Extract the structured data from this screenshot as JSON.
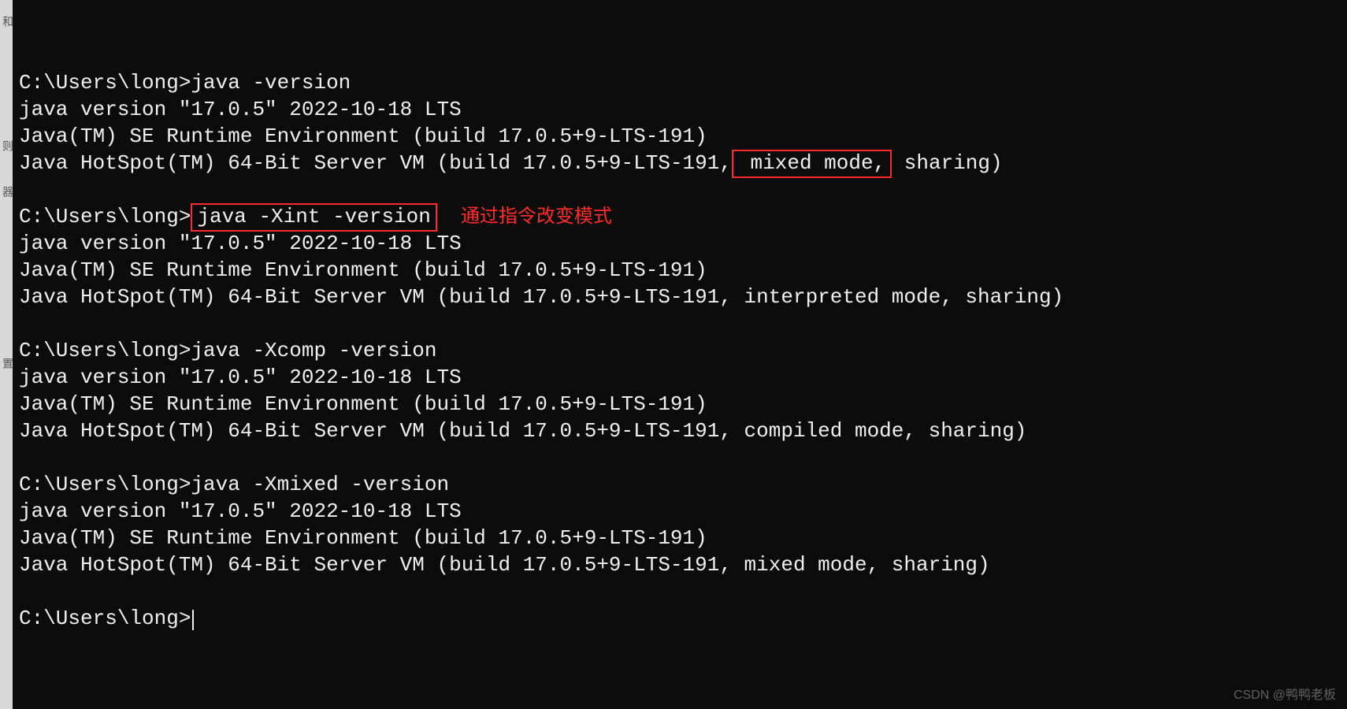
{
  "left_strip": {
    "chars": [
      "和",
      "则",
      "器",
      "置"
    ]
  },
  "terminal": {
    "prompt": "C:\\Users\\long>",
    "annotation": "通过指令改变模式",
    "blocks": [
      {
        "cmd": "java -version",
        "boxed_cmd": false,
        "out1": "java version \"17.0.5\" 2022-10-18 LTS",
        "out2": "Java(TM) SE Runtime Environment (build 17.0.5+9-LTS-191)",
        "vm_pre": "Java HotSpot(TM) 64-Bit Server VM (build 17.0.5+9-LTS-191,",
        "vm_mode": " mixed mode,",
        "vm_post": " sharing)",
        "box_mode": true
      },
      {
        "cmd": "java -Xint -version",
        "boxed_cmd": true,
        "out1": "java version \"17.0.5\" 2022-10-18 LTS",
        "out2": "Java(TM) SE Runtime Environment (build 17.0.5+9-LTS-191)",
        "vm_pre": "Java HotSpot(TM) 64-Bit Server VM (build 17.0.5+9-LTS-191, interpreted mode, sharing)",
        "vm_mode": "",
        "vm_post": "",
        "box_mode": false,
        "has_annotation": true
      },
      {
        "cmd": "java -Xcomp -version",
        "boxed_cmd": false,
        "out1": "java version \"17.0.5\" 2022-10-18 LTS",
        "out2": "Java(TM) SE Runtime Environment (build 17.0.5+9-LTS-191)",
        "vm_pre": "Java HotSpot(TM) 64-Bit Server VM (build 17.0.5+9-LTS-191, compiled mode, sharing)",
        "vm_mode": "",
        "vm_post": "",
        "box_mode": false
      },
      {
        "cmd": "java -Xmixed -version",
        "boxed_cmd": false,
        "out1": "java version \"17.0.5\" 2022-10-18 LTS",
        "out2": "Java(TM) SE Runtime Environment (build 17.0.5+9-LTS-191)",
        "vm_pre": "Java HotSpot(TM) 64-Bit Server VM (build 17.0.5+9-LTS-191, mixed mode, sharing)",
        "vm_mode": "",
        "vm_post": "",
        "box_mode": false
      }
    ]
  },
  "watermark": "CSDN @鸭鸭老板"
}
